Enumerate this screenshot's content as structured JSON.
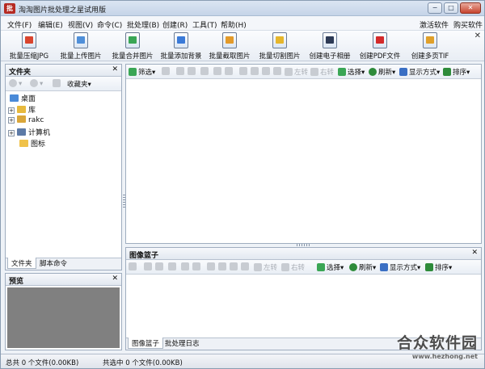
{
  "window": {
    "title": "淘淘图片批处理之星试用版",
    "icon_text": "批",
    "controls": [
      "−",
      "□",
      "✕"
    ]
  },
  "menu": {
    "items": [
      "文件(F)",
      "编辑(E)",
      "视图(V)",
      "命令(C)",
      "批处理(B)",
      "创建(R)",
      "工具(T)",
      "帮助(H)"
    ],
    "right": [
      "激活软件",
      "购买软件"
    ]
  },
  "toolbar": {
    "buttons": [
      {
        "label": "批量压缩JPG",
        "icon": "compress-jpg-icon",
        "color": "#d9442e"
      },
      {
        "label": "批量上传图片",
        "icon": "upload-image-icon",
        "color": "#4f8fd9"
      },
      {
        "label": "批量合并图片",
        "icon": "merge-images-icon",
        "color": "#3aa655"
      },
      {
        "label": "批量添加背景",
        "icon": "add-background-icon",
        "color": "#3a7ad8"
      },
      {
        "label": "批量截取图片",
        "icon": "crop-image-icon",
        "color": "#e39a2a"
      },
      {
        "label": "批量切割图片",
        "icon": "cut-image-icon",
        "color": "#e6b62c"
      },
      {
        "label": "创建电子相册",
        "icon": "photo-album-icon",
        "color": "#2d3a55"
      },
      {
        "label": "创建PDF文件",
        "icon": "pdf-icon",
        "color": "#d42a2a"
      },
      {
        "label": "创建多页TIF",
        "icon": "tif-icon",
        "color": "#e0a02a"
      }
    ],
    "close": "✕"
  },
  "left_panel": {
    "title": "文件夹",
    "close": "✕",
    "favorites": "收藏夹",
    "tree": [
      {
        "label": "桌面",
        "expander": "",
        "icon": "desktop-icon",
        "color": "#4a8ad8"
      },
      {
        "label": "库",
        "expander": "+",
        "icon": "library-icon",
        "color": "#e7b93d"
      },
      {
        "label": "rakc",
        "expander": "+",
        "icon": "user-folder-icon",
        "color": "#d9a63a"
      },
      {
        "label": "计算机",
        "expander": "+",
        "icon": "computer-icon",
        "color": "#5d7aa6"
      },
      {
        "label": "图标",
        "expander": "",
        "icon": "folder-icon",
        "color": "#f0c24a"
      }
    ],
    "tabs": [
      "文件夹",
      "脚本命令"
    ]
  },
  "preview_panel": {
    "title": "预览",
    "close": "✕"
  },
  "main_toolbar": {
    "filter": "筛选",
    "rotate_left": "左转",
    "rotate_right": "右转",
    "select": "选择",
    "refresh": "刷新",
    "display_mode": "显示方式",
    "sort": "排序"
  },
  "basket_panel": {
    "title": "图像篮子",
    "close": "✕",
    "rotate_left": "左转",
    "rotate_right": "右转",
    "select": "选择",
    "refresh": "刷新",
    "display_mode": "显示方式",
    "sort": "排序",
    "tabs": [
      "图像篮子",
      "批处理日志"
    ]
  },
  "status": {
    "total": "总共 0 个文件(0.00KB)",
    "selected": "共选中 0 个文件(0.00KB)"
  },
  "watermark": {
    "main": "合众软件园",
    "sub": "www.hezhong.net"
  }
}
